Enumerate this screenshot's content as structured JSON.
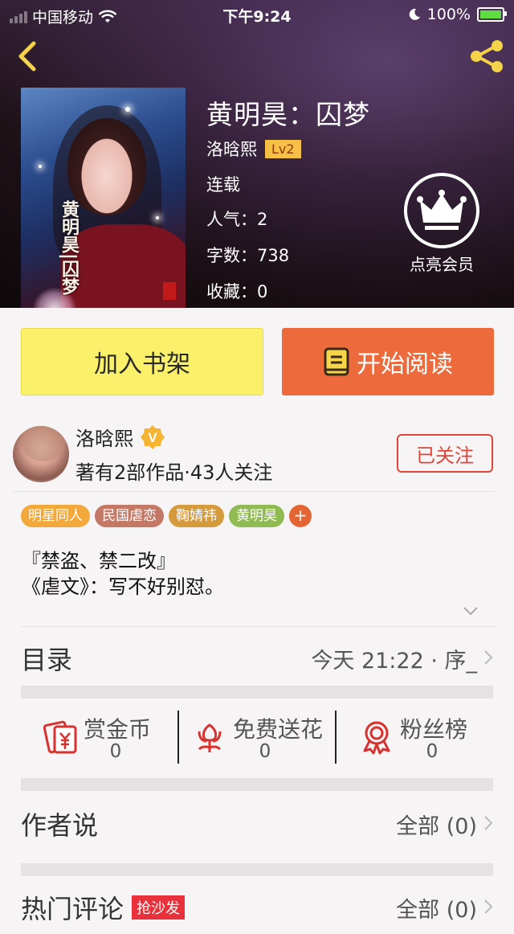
{
  "status_bar": {
    "carrier": "中国移动",
    "time": "下午9:24",
    "battery": "100%"
  },
  "book": {
    "title": "黄明昊：囚梦",
    "author": "洛晗熙",
    "level": "Lv2",
    "status": "连载",
    "popularity_label": "人气：",
    "popularity_value": "2",
    "words_label": "字数：",
    "words_value": "738",
    "favorites_label": "收藏：",
    "favorites_value": "0",
    "cover_title": "黄明昊|囚梦"
  },
  "vip": {
    "label": "点亮会员"
  },
  "buttons": {
    "add_shelf": "加入书架",
    "start_read": "开始阅读"
  },
  "author_card": {
    "name": "洛晗熙",
    "verified_badge": "V",
    "description": "著有2部作品·43人关注",
    "follow_label": "已关注"
  },
  "tags": [
    {
      "label": "明星同人",
      "color": "#f3a83b"
    },
    {
      "label": "民国虐恋",
      "color": "#c47866"
    },
    {
      "label": "鞠婧祎",
      "color": "#d49a3c"
    },
    {
      "label": "黄明昊",
      "color": "#8fbb52"
    }
  ],
  "tag_add": "+",
  "intro": {
    "line1": "『禁盗、禁二改』",
    "line2": "《虐文》：写不好别怼。"
  },
  "catalog": {
    "label": "目录",
    "latest": "今天 21:22 · 序_"
  },
  "actions": [
    {
      "label": "赏金币",
      "count": "0",
      "icon": "red-envelope-icon"
    },
    {
      "label": "免费送花",
      "count": "0",
      "icon": "flower-icon"
    },
    {
      "label": "粉丝榜",
      "count": "0",
      "icon": "ribbon-medal-icon"
    }
  ],
  "author_says": {
    "label": "作者说",
    "all": "全部 (0)"
  },
  "hot_comments": {
    "label": "热门评论",
    "badge": "抢沙发",
    "all": "全部 (0)"
  },
  "colors": {
    "accent_orange": "#ec6a3b",
    "shelf_yellow": "#fbf06a",
    "follow_red": "#e0453a",
    "level_badge": "#f5c045"
  }
}
